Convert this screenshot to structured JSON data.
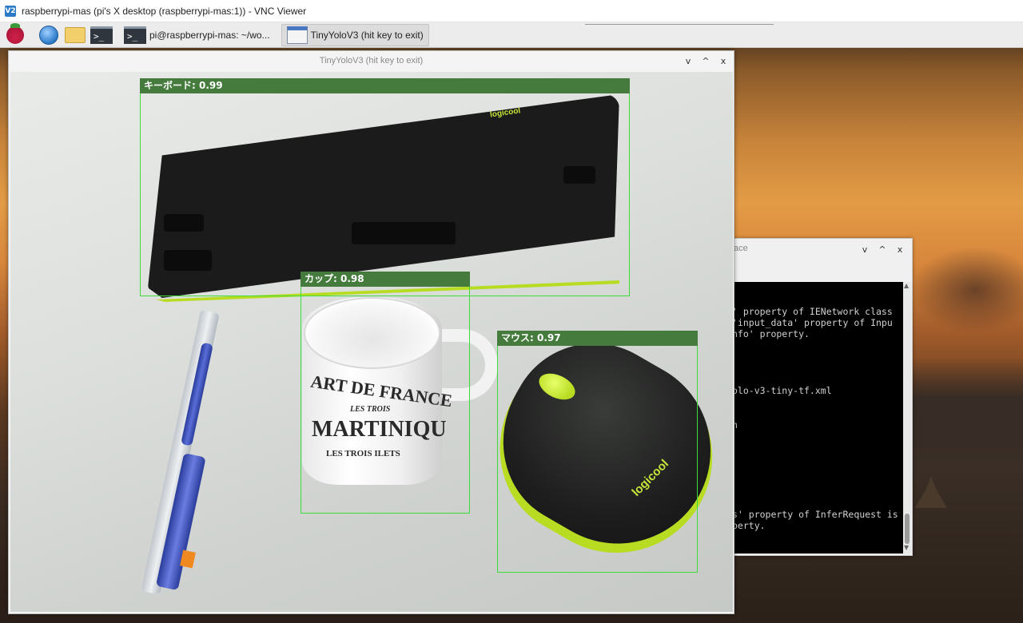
{
  "vnc": {
    "title": "raspberrypi-mas (pi's X desktop (raspberrypi-mas:1)) - VNC Viewer",
    "icon_text": "V2"
  },
  "taskbar": {
    "icons": [
      "raspberry-pi-menu-icon",
      "web-browser-icon",
      "file-manager-icon",
      "terminal-icon"
    ],
    "tasks": [
      {
        "label": "pi@raspberrypi-mas: ~/wo...",
        "icon": "terminal-icon"
      },
      {
        "label": "TinyYoloV3 (hit key to exit)",
        "icon": "window-icon"
      }
    ]
  },
  "yolo_window": {
    "title": "TinyYoloV3 (hit key to exit)",
    "controls": [
      "v",
      "^",
      "x"
    ],
    "camera_text": {
      "mug_lines": [
        "ART DE FRANCE",
        "LES TROIS",
        "MARTINIQU",
        "LES TROIS ILETS"
      ],
      "keyboard_brand": "logicool",
      "mouse_brand": "logicool"
    },
    "detections": [
      {
        "label": "キーボード: 0.99"
      },
      {
        "label": "カップ: 0.98"
      },
      {
        "label": "マウス: 0.97"
      }
    ]
  },
  "terminal_window": {
    "title_fragment": "ace",
    "controls": [
      "v",
      "^",
      "x"
    ],
    "lines": [
      "' property of IENetwork class",
      "'input_data' property of Inpu",
      "nfo' property.",
      "olo-v3-tiny-tf.xml",
      "n",
      "s' property of InferRequest is",
      "perty."
    ]
  },
  "colors": {
    "detection_box": "#3cdc3c",
    "detection_label_bg": "#457c3e",
    "accent_lime": "#b8dc22"
  }
}
